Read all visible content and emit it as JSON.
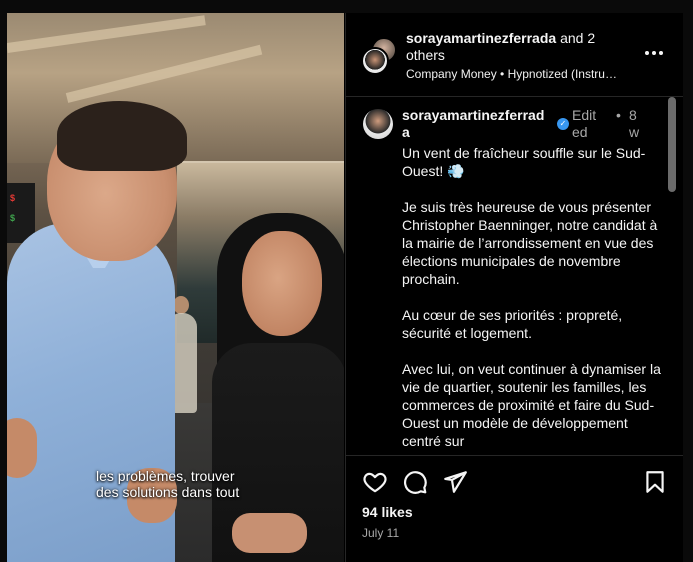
{
  "video": {
    "caption_line1": "les problèmes, trouver",
    "caption_line2": "des solutions dans tout"
  },
  "header": {
    "username": "sorayamartinezferrada",
    "others": "and 2 others",
    "audio_line": "Company Money • Hypnotized (Instru…",
    "more_icon": "more-horizontal-icon"
  },
  "post": {
    "username": "sorayamartinezferrada",
    "verified_icon": "verified-badge-icon",
    "edited": "Edited",
    "dot": "•",
    "time_ago": "8w",
    "paragraphs": [
      "Un vent de fraîcheur souffle sur le Sud-Ouest! 💨",
      "Je suis très heureuse de vous présenter Christopher Baenninger, notre candidat à la mairie de l’arrondissement en vue des élections municipales de novembre prochain.",
      "Au cœur de ses priorités : propreté, sécurité et logement.",
      "Avec lui, on veut continuer à dynamiser la vie de quartier, soutenir les familles, les commerces de proximité et faire du Sud-Ouest un modèle de développement centré sur"
    ]
  },
  "actions": {
    "icons": [
      "heart-icon",
      "comment-icon",
      "share-icon",
      "bookmark-icon"
    ],
    "likes": "94 likes",
    "date": "July 11"
  },
  "colors": {
    "background": "#000000",
    "text": "#f5f5f5",
    "muted": "#a8a8a8",
    "verified": "#3897f0",
    "divider": "#262626"
  }
}
